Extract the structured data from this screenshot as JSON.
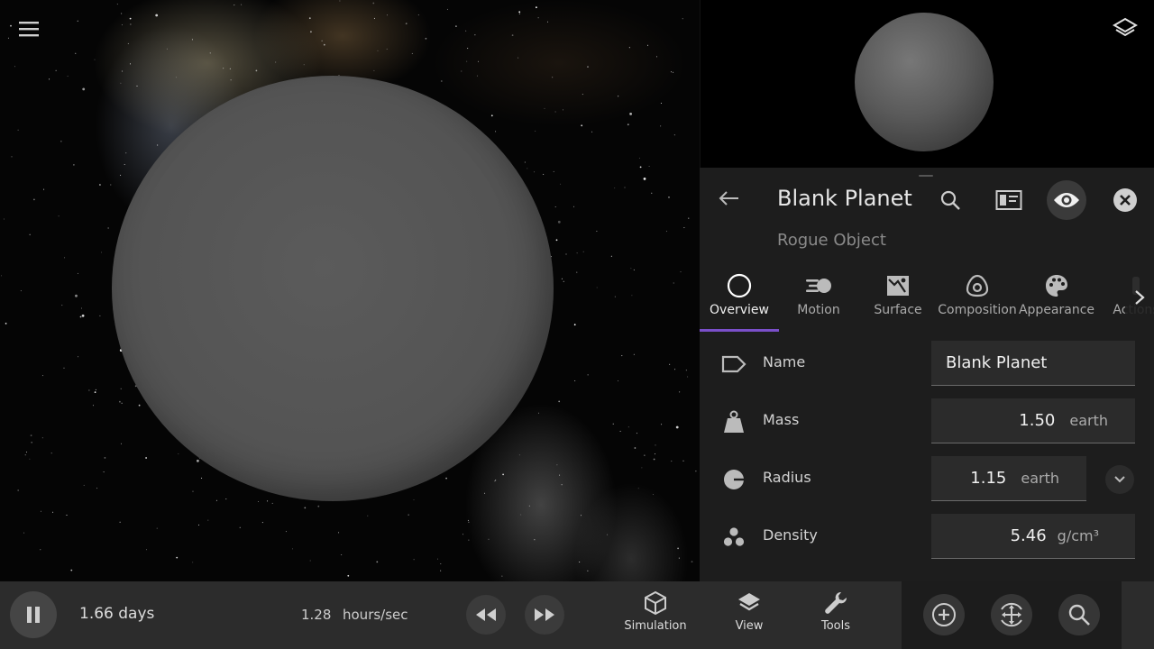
{
  "header": {
    "object_title": "Blank Planet",
    "object_subtitle": "Rogue Object"
  },
  "tabs": [
    {
      "label": "Overview",
      "icon": "circle-icon",
      "active": true
    },
    {
      "label": "Motion",
      "icon": "motion-icon"
    },
    {
      "label": "Surface",
      "icon": "surface-map-icon"
    },
    {
      "label": "Composition",
      "icon": "composition-icon"
    },
    {
      "label": "Appearance",
      "icon": "palette-icon"
    },
    {
      "label": "Actions",
      "icon": "actions-icon"
    }
  ],
  "properties": {
    "name": {
      "label": "Name",
      "value": "Blank Planet"
    },
    "mass": {
      "label": "Mass",
      "value": "1.50",
      "unit": "earth"
    },
    "radius": {
      "label": "Radius",
      "value": "1.15",
      "unit": "earth"
    },
    "density": {
      "label": "Density",
      "value": "5.46",
      "unit": "g/cm³"
    }
  },
  "bottombar": {
    "elapsed_time": "1.66 days",
    "rate_value": "1.28",
    "rate_unit": "hours/sec",
    "nav": [
      {
        "label": "Simulation",
        "icon": "cube-icon"
      },
      {
        "label": "View",
        "icon": "layers-icon"
      },
      {
        "label": "Tools",
        "icon": "wrench-icon"
      }
    ]
  },
  "colors": {
    "accent": "#7a4fc9",
    "panel_bg": "#1d1d1d",
    "bar_bg": "#2c2c2c"
  }
}
